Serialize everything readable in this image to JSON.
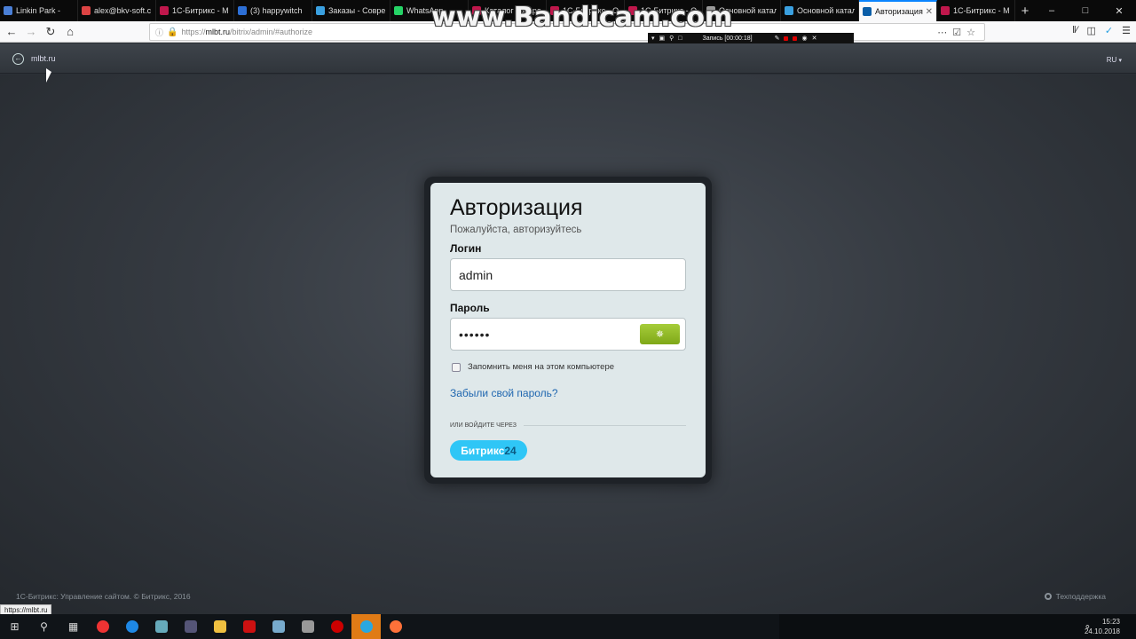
{
  "browser": {
    "tabs": [
      {
        "label": "Linkin Park -",
        "color": "#4a7fd6",
        "active": false
      },
      {
        "label": "alex@bkv-soft.c",
        "color": "#d44",
        "active": false
      },
      {
        "label": "1С-Битрикс - М",
        "color": "#c0174c",
        "active": false
      },
      {
        "label": "(3) happywitch",
        "color": "#2d6fd6",
        "active": false
      },
      {
        "label": "Заказы - Совре",
        "color": "#3aa0e0",
        "active": false
      },
      {
        "label": "WhatsApp",
        "color": "#25d366",
        "active": false
      },
      {
        "label": "Каталог товаро",
        "color": "#c0174c",
        "active": false
      },
      {
        "label": "1С-Битрикс - О",
        "color": "#c0174c",
        "active": false
      },
      {
        "label": "1С-Битрикс - О",
        "color": "#c0174c",
        "active": false
      },
      {
        "label": "Основной катал",
        "color": "#999",
        "active": false
      },
      {
        "label": "Основной катал",
        "color": "#3aa0e0",
        "active": false
      },
      {
        "label": "Авторизация",
        "color": "#0a5ea8",
        "active": true
      },
      {
        "label": "1С-Битрикс - М",
        "color": "#c0174c",
        "active": false
      }
    ],
    "new_tab": "+",
    "url_scheme": "https://",
    "url_host": "mlbt.ru",
    "url_path": "/bitrix/admin/#authorize",
    "status_url": "https://mlbt.ru"
  },
  "overlay": {
    "watermark": "www.Bandicam.com",
    "recording": "Запись [00:00:18]"
  },
  "admin_bar": {
    "site": "mlbt.ru",
    "lang": "RU"
  },
  "login": {
    "title": "Авторизация",
    "subtitle": "Пожалуйста, авторизуйтесь",
    "login_label": "Логин",
    "login_value": "admin",
    "password_label": "Пароль",
    "password_value": "••••••",
    "remember_label": "Запомнить меня на этом компьютере",
    "forgot_label": "Забыли свой пароль?",
    "or_label": "или войдите через",
    "b24_text": "Битрикс",
    "b24_num": "24"
  },
  "footer": {
    "copyright": "1С-Битрикс: Управление сайтом. © Битрикс, 2016",
    "support": "Техподдержка"
  },
  "taskbar": {
    "time": "15:23",
    "date": "24.10.2018"
  }
}
